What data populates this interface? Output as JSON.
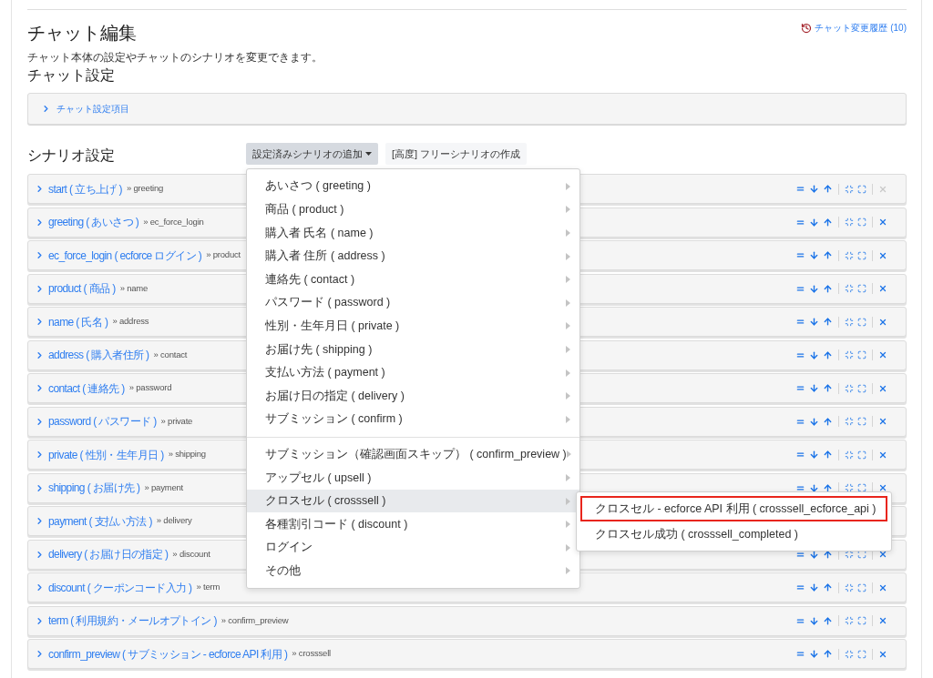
{
  "title": "チャット編集",
  "history_link": "チャット変更履歴 (10)",
  "description": "チャット本体の設定やチャットのシナリオを変更できます。",
  "chat_settings": {
    "heading": "チャット設定",
    "panel_label": "チャット設定項目"
  },
  "scenario_settings": {
    "heading": "シナリオ設定",
    "buttons": [
      {
        "label": "設定済みシナリオの追加",
        "kind": "dropdown",
        "selected": true
      },
      {
        "label": "[高度] フリーシナリオの作成",
        "kind": "plain",
        "selected": false
      }
    ]
  },
  "scenarios": [
    {
      "label": "start ( 立ち上げ )",
      "next": "» greeting",
      "removable": false
    },
    {
      "label": "greeting ( あいさつ )",
      "next": "» ec_force_login",
      "removable": true
    },
    {
      "label": "ec_force_login ( ecforce ログイン )",
      "next": "» product",
      "removable": true
    },
    {
      "label": "product ( 商品 )",
      "next": "» name",
      "removable": true
    },
    {
      "label": "name ( 氏名 )",
      "next": "» address",
      "removable": true
    },
    {
      "label": "address ( 購入者住所 )",
      "next": "» contact",
      "removable": true
    },
    {
      "label": "contact ( 連絡先 )",
      "next": "» password",
      "removable": true
    },
    {
      "label": "password ( パスワード )",
      "next": "» private",
      "removable": true
    },
    {
      "label": "private ( 性別・生年月日 )",
      "next": "» shipping",
      "removable": true
    },
    {
      "label": "shipping ( お届け先 )",
      "next": "» payment",
      "removable": true
    },
    {
      "label": "payment ( 支払い方法 )",
      "next": "» delivery"
    },
    {
      "label": "delivery ( お届け日の指定 )",
      "next": "» discount",
      "removable": true
    },
    {
      "label": "discount ( クーポンコード入力 )",
      "next": "» term",
      "removable": true
    },
    {
      "label": "term ( 利用規約・メールオプトイン )",
      "next": "» confirm_preview",
      "removable": true
    },
    {
      "label": "confirm_preview ( サブミッション - ecforce API 利用 )",
      "next": "» crosssell",
      "removable": true
    }
  ],
  "dropdown_menu": {
    "groups": [
      {
        "items": [
          {
            "label": "あいさつ ( greeting )",
            "selected": false
          },
          {
            "label": "商品 ( product )",
            "selected": false
          },
          {
            "label": "購入者 氏名 ( name )",
            "selected": false
          },
          {
            "label": "購入者 住所 ( address )",
            "selected": false
          },
          {
            "label": "連絡先 ( contact )",
            "selected": false
          },
          {
            "label": "パスワード ( password )",
            "selected": false
          },
          {
            "label": "性別・生年月日 ( private )",
            "selected": false
          },
          {
            "label": "お届け先 ( shipping )",
            "selected": false
          },
          {
            "label": "支払い方法 ( payment )",
            "selected": false
          },
          {
            "label": "お届け日の指定 ( delivery )",
            "selected": false
          },
          {
            "label": "サブミッション ( confirm )",
            "selected": false
          }
        ]
      },
      {
        "items": [
          {
            "label": "サブミッション（確認画面スキップ） ( confirm_preview )",
            "selected": false
          },
          {
            "label": "アップセル ( upsell )",
            "selected": false
          },
          {
            "label": "クロスセル ( crosssell )",
            "selected": true
          },
          {
            "label": "各種割引コード ( discount )",
            "selected": false
          },
          {
            "label": "ログイン",
            "selected": false
          },
          {
            "label": "その他",
            "selected": false
          }
        ]
      }
    ]
  },
  "submenu": {
    "items": [
      {
        "label": "クロスセル - ecforce API 利用 ( crosssell_ecforce_api )",
        "highlighted": true
      },
      {
        "label": "クロスセル成功 ( crosssell_completed )",
        "highlighted": false
      }
    ]
  }
}
